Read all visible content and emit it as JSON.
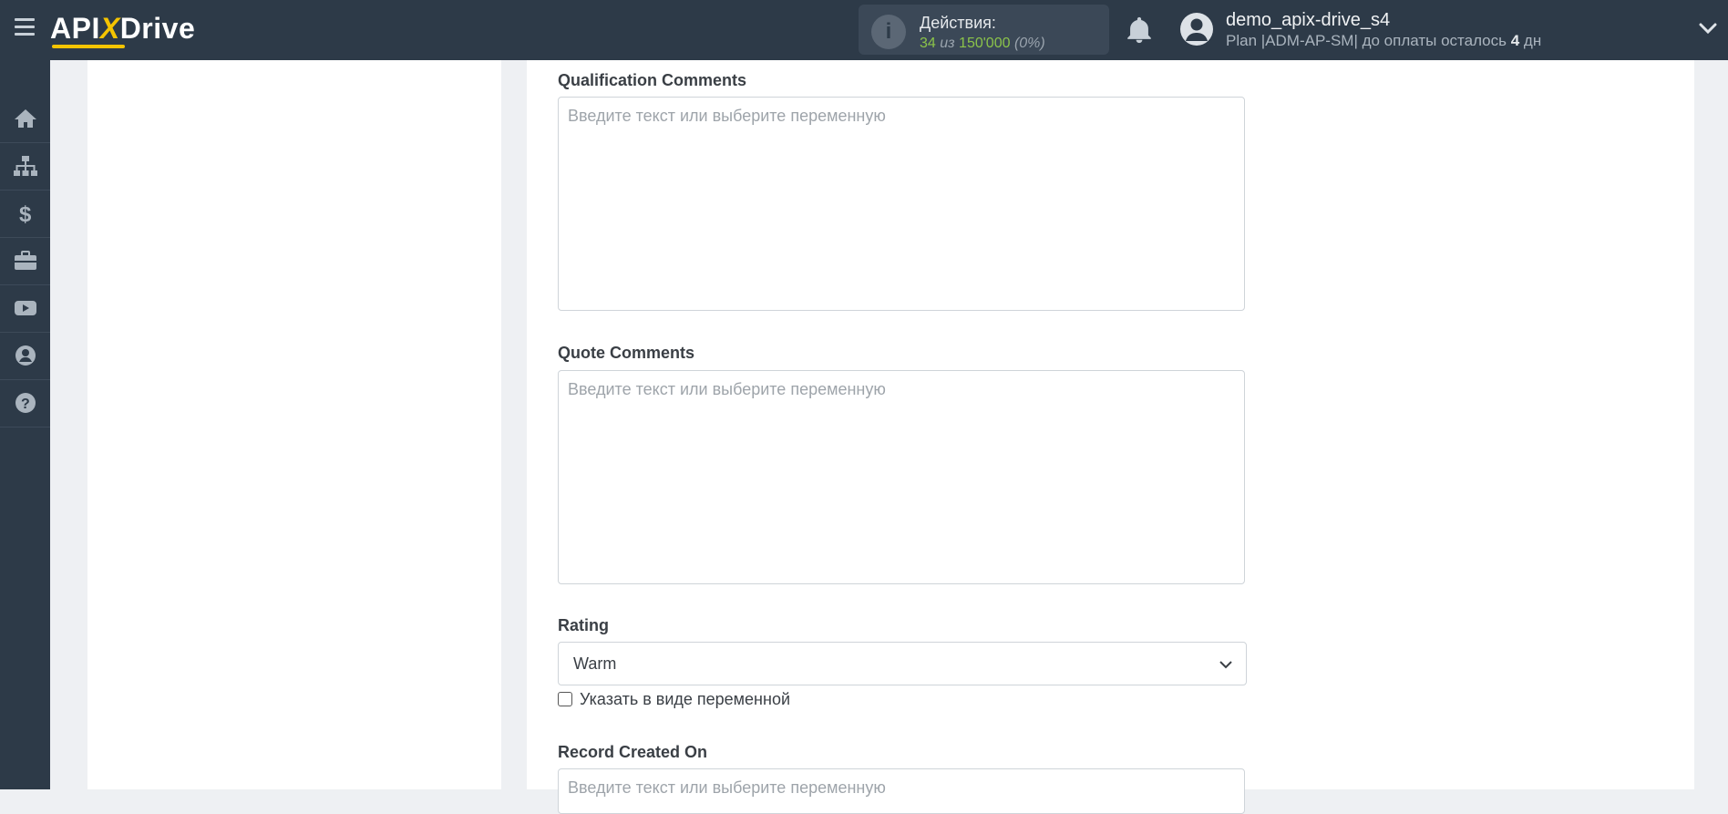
{
  "header": {
    "logo": {
      "part1": "API",
      "part2": "X",
      "part3": "Drive"
    },
    "actions": {
      "title": "Действия:",
      "used": "34",
      "of_label": "из",
      "limit": "150'000",
      "percent": "(0%)"
    },
    "user": {
      "name": "demo_apix-drive_s4",
      "plan_prefix": "Plan |ADM-AP-SM| до оплаты осталось ",
      "days": "4",
      "days_suffix": " дн"
    }
  },
  "sidebar": {
    "items": [
      {
        "icon": "home-icon"
      },
      {
        "icon": "sitemap-icon"
      },
      {
        "icon": "dollar-icon"
      },
      {
        "icon": "briefcase-icon"
      },
      {
        "icon": "youtube-icon"
      },
      {
        "icon": "user-circle-icon"
      },
      {
        "icon": "question-icon"
      }
    ]
  },
  "form": {
    "qualification_comments": {
      "label": "Qualification Comments",
      "placeholder": "Введите текст или выберите переменную"
    },
    "quote_comments": {
      "label": "Quote Comments",
      "placeholder": "Введите текст или выберите переменную"
    },
    "rating": {
      "label": "Rating",
      "value": "Warm",
      "checkbox_label": "Указать в виде переменной"
    },
    "record_created_on": {
      "label": "Record Created On",
      "placeholder": "Введите текст или выберите переменную"
    }
  },
  "colors": {
    "header_bg": "#2d3a48",
    "accent_yellow": "#f5c400",
    "accent_green": "#8bc34a",
    "page_bg": "#eef0f3"
  }
}
